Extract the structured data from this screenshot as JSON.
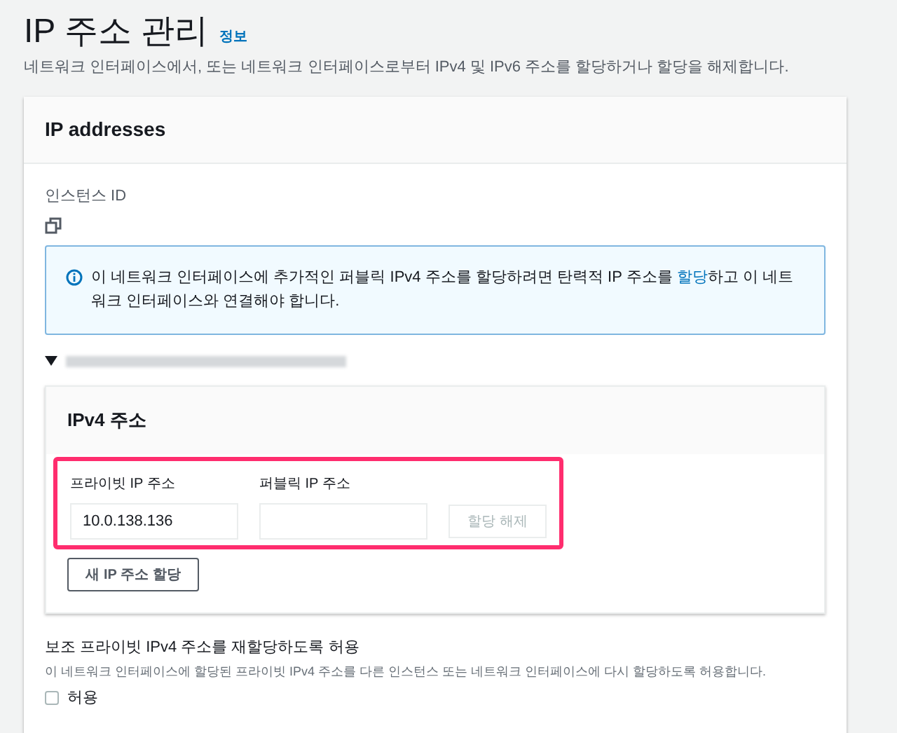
{
  "page": {
    "title": "IP 주소 관리",
    "info_link": "정보",
    "description": "네트워크 인터페이스에서, 또는 네트워크 인터페이스로부터 IPv4 및 IPv6 주소를 할당하거나 할당을 해제합니다."
  },
  "card": {
    "title": "IP addresses",
    "instance_label": "인스턴스 ID",
    "alert": {
      "before": "이 네트워크 인터페이스에 추가적인 퍼블릭 IPv4 주소를 할당하려면 탄력적 IP 주소를",
      "link": "할당",
      "after": "하고 이 네트워크 인터페이스와 연결해야 합니다."
    },
    "interface": {
      "expanded": true,
      "ipv4": {
        "title": "IPv4 주소",
        "highlighted": true,
        "columns": [
          {
            "label": "프라이빗 IP 주소"
          },
          {
            "label": "퍼블릭 IP 주소"
          }
        ],
        "row": {
          "private_ip": "10.0.138.136",
          "unassign": {
            "label": "할당 해제",
            "disabled": true
          }
        },
        "add_button": "새 IP 주소 할당"
      }
    },
    "reassign": {
      "title": "보조 프라이빗 IPv4 주소를 재할당하도록 허용",
      "description": "이 네트워크 인터페이스에 할당된 프라이빗 IPv4 주소를 다른 인스턴스 또는 네트워크 인터페이스에 다시 할당하도록 허용합니다.",
      "checkbox": {
        "label": "허용",
        "checked": false
      }
    }
  }
}
